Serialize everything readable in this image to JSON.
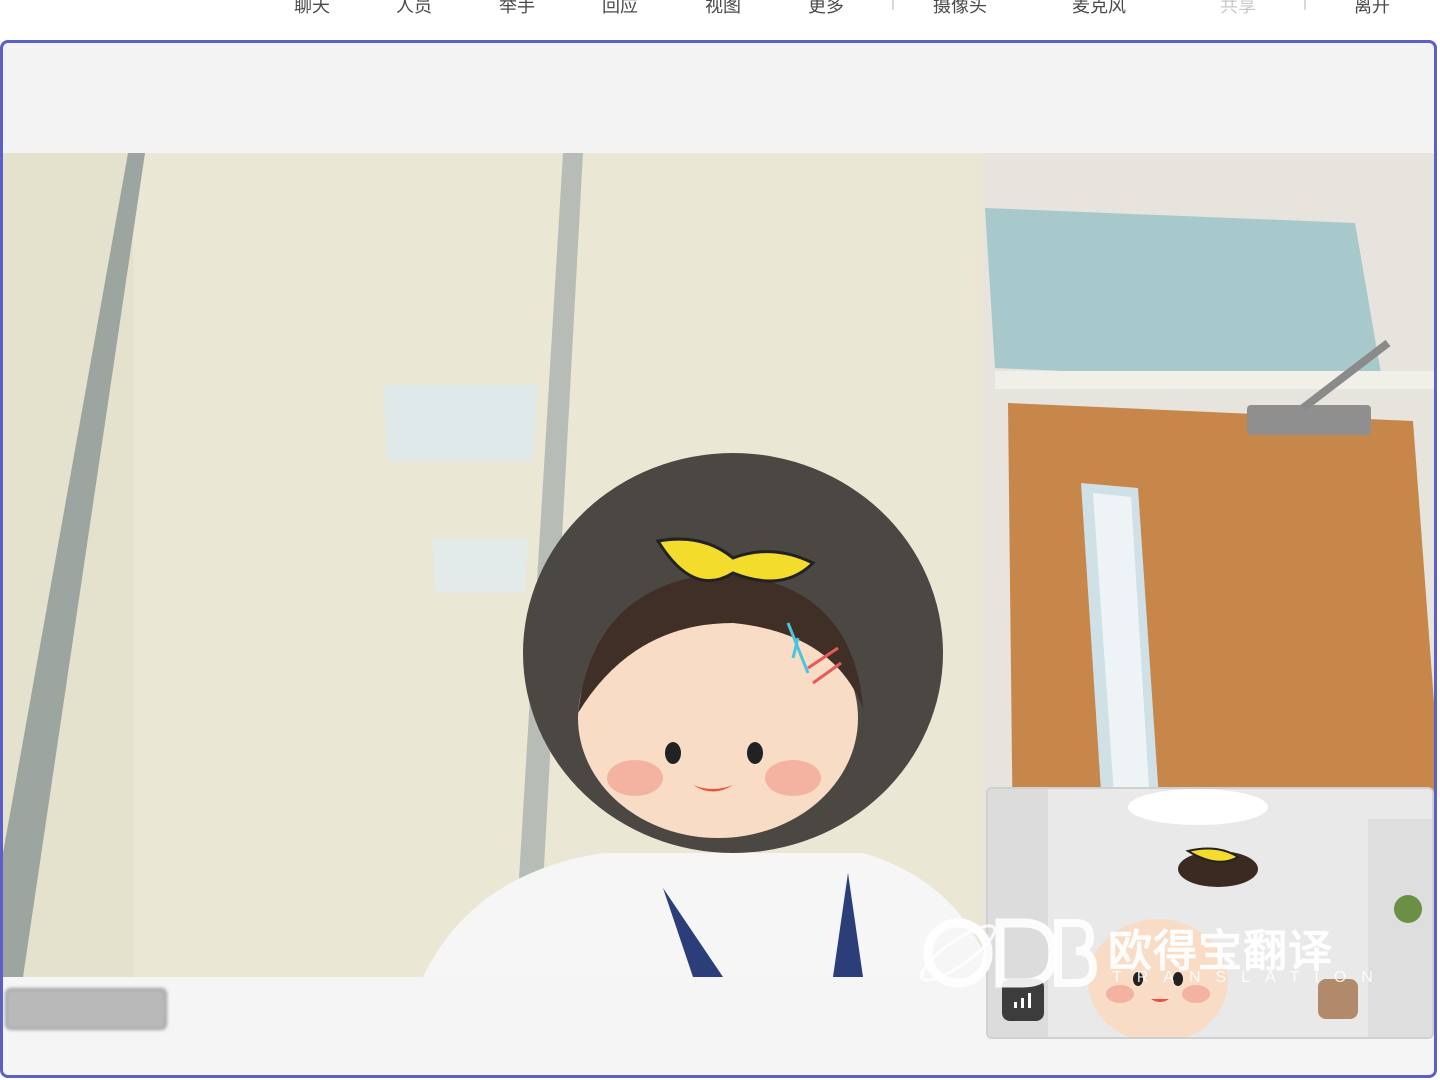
{
  "toolbar": {
    "items": [
      {
        "label": "聊天",
        "icon": "chat-icon"
      },
      {
        "label": "人员",
        "icon": "people-icon"
      },
      {
        "label": "举手",
        "icon": "raise-hand-icon"
      },
      {
        "label": "回应",
        "icon": "react-icon"
      },
      {
        "label": "视图",
        "icon": "view-icon"
      },
      {
        "label": "更多",
        "icon": "more-icon"
      },
      {
        "label": "摄像头",
        "icon": "camera-icon"
      },
      {
        "label": "麦克风",
        "icon": "mic-icon"
      },
      {
        "label": "共享",
        "icon": "share-icon",
        "disabled": true
      },
      {
        "label": "离开",
        "icon": "leave-icon"
      }
    ]
  },
  "stage": {
    "accent_color": "#5b5fc7",
    "participant_name": ""
  },
  "self_view": {
    "signal_icon": "signal-bars-icon"
  },
  "watermark": {
    "logo": "ODB",
    "cn_text": "欧得宝翻译",
    "en_text": "TRANSLATION"
  }
}
